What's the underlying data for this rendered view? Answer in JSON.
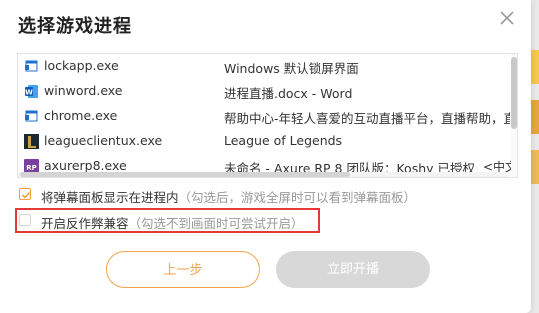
{
  "dialog": {
    "title": "选择游戏进程",
    "close_icon": "close-icon"
  },
  "processes": [
    {
      "name": "lockapp.exe",
      "window_title": "Windows 默认锁屏界面",
      "icon": "app-window-icon",
      "extra": ""
    },
    {
      "name": "winword.exe",
      "window_title": "进程直播.docx - Word",
      "icon": "word-icon",
      "extra": ""
    },
    {
      "name": "chrome.exe",
      "window_title": "帮助中心-年轻人喜爱的互动直播平台，直播帮助，直播",
      "icon": "app-window-icon",
      "extra": ""
    },
    {
      "name": "leagueclientux.exe",
      "window_title": "League of Legends",
      "icon": "league-icon",
      "extra": ""
    },
    {
      "name": "axurerp8.exe",
      "window_title": "未命名 - Axure RP 8 团队版：Koshy 已授权",
      "icon": "axure-icon",
      "extra": "<中文"
    }
  ],
  "options": {
    "show_panel": {
      "label": "将弹幕面板显示在进程内",
      "hint": "（勾选后，游戏全屏时可以看到弹幕面板）",
      "checked": true
    },
    "anti_cheat": {
      "label": "开启反作弊兼容",
      "hint": "（勾选不到画面时可尝试开启）",
      "checked": false
    }
  },
  "buttons": {
    "prev": "上一步",
    "start": "立即开播"
  },
  "colors": {
    "accent": "#f3a54a",
    "highlight_border": "#e53935",
    "disabled_button": "#d8d8d8"
  }
}
